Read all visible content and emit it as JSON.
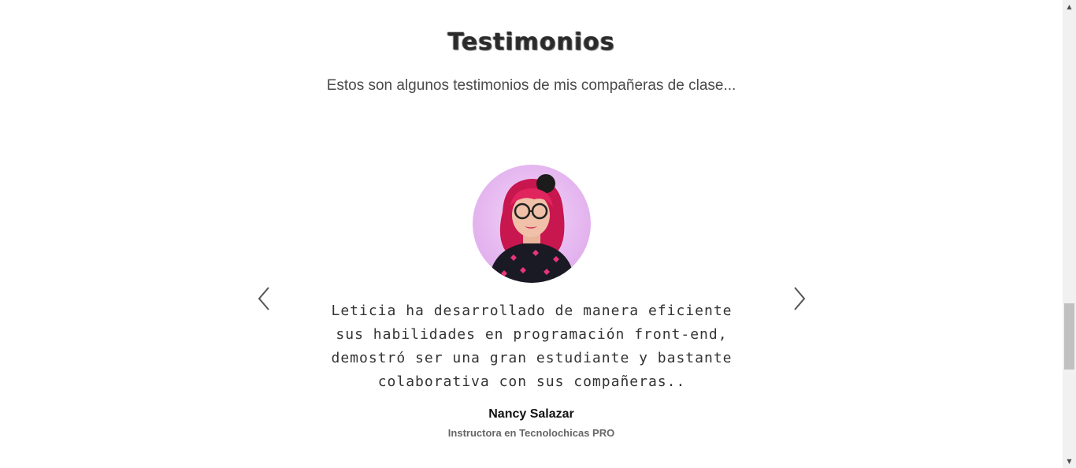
{
  "section": {
    "title": "Testimonios",
    "subtitle": "Estos son algunos testimonios de mis compañeras de clase..."
  },
  "testimonial": {
    "quote": "Leticia ha desarrollado de manera eficiente sus habilidades en programación front-end, demostró ser una gran estudiante y bastante colaborativa con sus compañeras..",
    "author": "Nancy Salazar",
    "role": "Instructora en Tecnolochicas PRO",
    "avatar_icon": "person-photo-avatar"
  },
  "carousel": {
    "prev_icon": "chevron-left-icon",
    "next_icon": "chevron-right-icon"
  },
  "scrollbar": {
    "up_icon": "triangle-up-icon",
    "down_icon": "triangle-down-icon"
  },
  "colors": {
    "arrow": "#555555",
    "avatar_bg": "#e6b8f0",
    "hair": "#e0245e"
  }
}
